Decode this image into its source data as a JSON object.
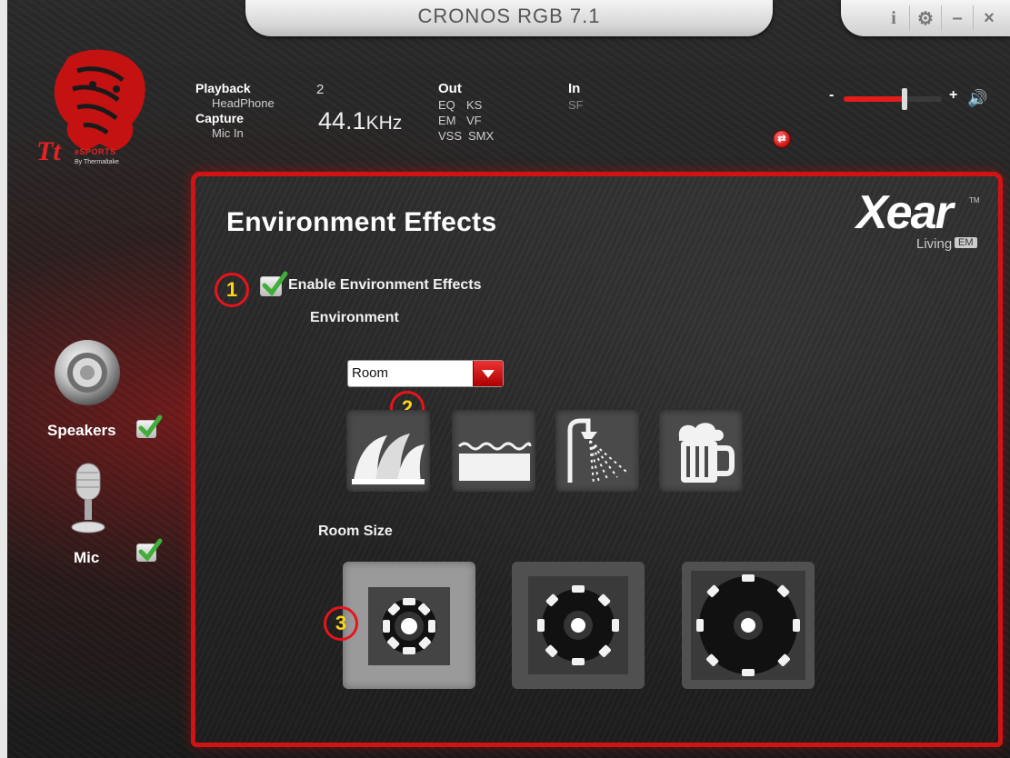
{
  "window": {
    "title": "CRONOS RGB 7.1",
    "controls": [
      "i",
      "⚙",
      "–",
      "×"
    ]
  },
  "brand": {
    "name": "Tt",
    "sub": "eSPORTS",
    "by": "By Thermaltake"
  },
  "header": {
    "playback_label": "Playback",
    "playback_device": "HeadPhone",
    "capture_label": "Capture",
    "capture_device": "Mic In",
    "channels": "2",
    "sample_rate": "44.1",
    "sample_unit": "KHz",
    "out_label": "Out",
    "out_row1a": "EQ",
    "out_row1b": "KS",
    "out_row2a": "EM",
    "out_row2b": "VF",
    "out_row3a": "VSS",
    "out_row3b": "SMX",
    "in_label": "In",
    "in_sf": "SF"
  },
  "volume": {
    "minus": "-",
    "plus": "+",
    "level": 0.62
  },
  "sidebar": {
    "speakers_label": "Speakers",
    "mic_label": "Mic"
  },
  "main": {
    "heading": "Environment Effects",
    "enable_label": "Enable Environment Effects",
    "enable_checked": true,
    "environment_label": "Environment",
    "environment_value": "Room",
    "room_size_label": "Room Size",
    "environment_icons": [
      "opera-house-icon",
      "water-icon",
      "shower-icon",
      "beer-mug-icon"
    ],
    "room_sizes": [
      "small",
      "medium",
      "large"
    ],
    "selected_room_size": "small"
  },
  "xear": {
    "logo": "Xear",
    "tm": "TM",
    "living": "Living",
    "em": "EM"
  },
  "markers": [
    "1",
    "2",
    "3"
  ],
  "colors": {
    "accent_red": "#d01414",
    "marker_yellow": "#ffd21a",
    "check_green": "#3fae3a"
  }
}
